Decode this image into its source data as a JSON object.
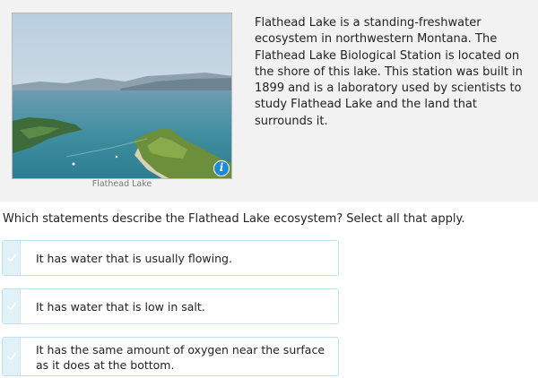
{
  "passage": {
    "image_caption": "Flathead Lake",
    "text": "Flathead Lake is a standing-freshwater ecosystem in northwestern Montana. The Flathead Lake Biological Station is located on the shore of this lake. This station was built in 1899 and is a laboratory used by scientists to study Flathead Lake and the land that surrounds it.",
    "info_icon_glyph": "i"
  },
  "question": {
    "prompt": "Which statements describe the Flathead Lake ecosystem? Select all that apply."
  },
  "choices": [
    {
      "label": "It has water that is usually flowing.",
      "selected": false
    },
    {
      "label": "It has water that is low in salt.",
      "selected": false
    },
    {
      "label": "It has the same amount of oxygen near the surface as it does at the bottom.",
      "selected": false
    }
  ],
  "colors": {
    "accent": "#1f8ad1",
    "choice_border": "#bfe0ef",
    "check_bg": "#e1f1f8",
    "passage_bg": "#f2f2f2"
  },
  "icons": {
    "info": "info-icon",
    "check": "checkmark-icon"
  }
}
